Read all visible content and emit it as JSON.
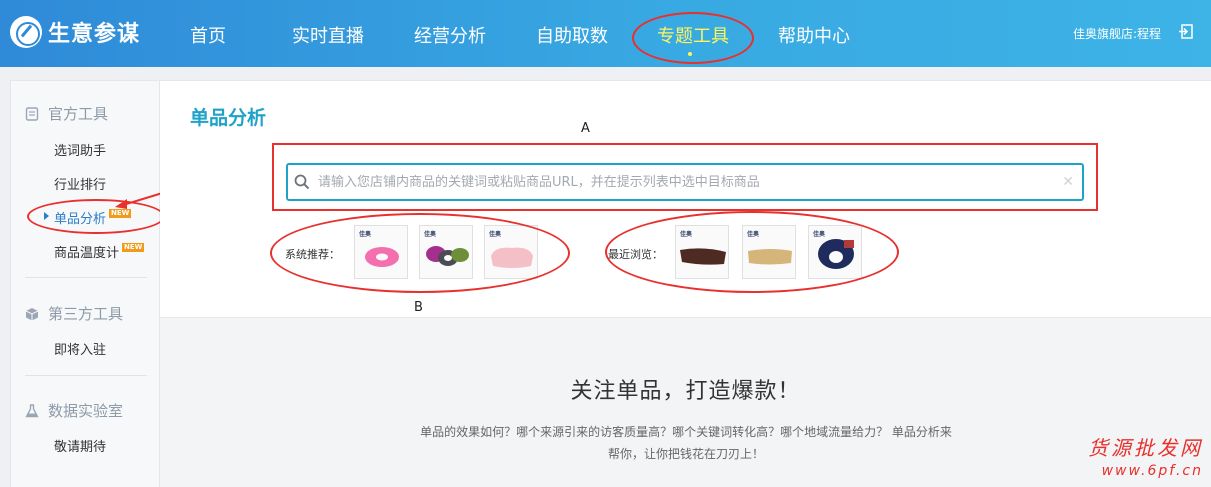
{
  "app": {
    "name": "生意参谋"
  },
  "nav": {
    "items": [
      {
        "label": "首页"
      },
      {
        "label": "实时直播"
      },
      {
        "label": "经营分析"
      },
      {
        "label": "自助取数"
      },
      {
        "label": "专题工具"
      },
      {
        "label": "帮助中心"
      }
    ],
    "active": "专题工具"
  },
  "user": {
    "label": "佳奥旗舰店:程程"
  },
  "sidebar": {
    "groups": [
      {
        "title": "官方工具",
        "items": [
          {
            "label": "选词助手"
          },
          {
            "label": "行业排行"
          },
          {
            "label": "单品分析",
            "badge": "NEW"
          },
          {
            "label": "商品温度计",
            "badge": "NEW"
          }
        ]
      },
      {
        "title": "第三方工具",
        "items": [
          {
            "label": "即将入驻"
          }
        ]
      },
      {
        "title": "数据实验室",
        "items": [
          {
            "label": "敬请期待"
          }
        ]
      }
    ],
    "active": "单品分析"
  },
  "main": {
    "title": "单品分析",
    "search": {
      "placeholder": "请输入您店铺内商品的关键词或粘贴商品URL，并在提示列表中选中目标商品",
      "value": ""
    },
    "recommend_label": "系统推荐：",
    "recent_label": "最近浏览：",
    "brand_mark": "佳奥",
    "hero_title": "关注单品，打造爆款！",
    "hero_desc": "单品的效果如何？哪个来源引来的访客质量高？哪个关键词转化高？哪个地域流量给力？ 单品分析来帮你，让你把钱花在刀刃上！"
  },
  "annotations": {
    "a": "A",
    "b": "B"
  },
  "watermark": {
    "line1": "货源批发网",
    "line2": "www.6pf.cn"
  },
  "colors": {
    "accent": "#1fa2c8",
    "nav_active": "#fff45e",
    "annotation_red": "#e8302c",
    "badge": "#f29b1a"
  }
}
